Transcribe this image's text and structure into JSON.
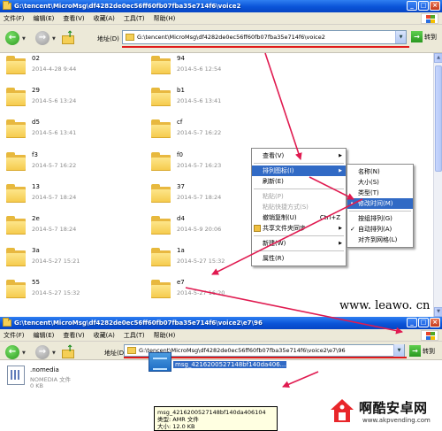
{
  "window1": {
    "title": "G:\\tencent\\MicroMsg\\df4282de0ec56ff60fb07fba35e714f6\\voice2",
    "menus": [
      "文件(F)",
      "编辑(E)",
      "查看(V)",
      "收藏(A)",
      "工具(T)",
      "帮助(H)"
    ],
    "address_label": "地址(D)",
    "address": "G:\\tencent\\MicroMsg\\df4282de0ec56ff60fb07fba35e714f6\\voice2",
    "go_label": "转到",
    "folders_left": [
      {
        "name": "02",
        "date": "2014-4-28 9:44"
      },
      {
        "name": "29",
        "date": "2014-5-6 13:24"
      },
      {
        "name": "d5",
        "date": "2014-5-6 13:41"
      },
      {
        "name": "f3",
        "date": "2014-5-7 16:22"
      },
      {
        "name": "13",
        "date": "2014-5-7 18:24"
      },
      {
        "name": "2e",
        "date": "2014-5-7 18:24"
      },
      {
        "name": "3a",
        "date": "2014-5-27 15:21"
      },
      {
        "name": "55",
        "date": "2014-5-27 15:32"
      }
    ],
    "folders_right": [
      {
        "name": "94",
        "date": "2014-5-6 12:54"
      },
      {
        "name": "b1",
        "date": "2014-5-6 13:41"
      },
      {
        "name": "cf",
        "date": "2014-5-7 16:22"
      },
      {
        "name": "f0",
        "date": "2014-5-7 16:23"
      },
      {
        "name": "37",
        "date": "2014-5-7 18:24"
      },
      {
        "name": "d4",
        "date": "2014-5-9 20:06"
      },
      {
        "name": "1a",
        "date": "2014-5-27 15:32"
      },
      {
        "name": "e7",
        "date": "2014-5-27 16:20"
      }
    ]
  },
  "context_menu": {
    "items": [
      {
        "label": "查看(V)",
        "arrow": true,
        "disabled": false
      },
      {
        "sep": true
      },
      {
        "label": "排列图标(I)",
        "arrow": true,
        "highlighted": true
      },
      {
        "label": "刷新(E)"
      },
      {
        "sep": true
      },
      {
        "label": "粘贴(P)",
        "disabled": true
      },
      {
        "label": "粘贴快捷方式(S)",
        "disabled": true
      },
      {
        "label": "撤销复制(U)",
        "shortcut": "Ctrl+Z"
      },
      {
        "label": "共享文件夹同步",
        "arrow": true,
        "icon": true
      },
      {
        "sep": true
      },
      {
        "label": "新建(W)",
        "arrow": true
      },
      {
        "sep": true
      },
      {
        "label": "属性(R)"
      }
    ]
  },
  "submenu": {
    "items": [
      {
        "label": "名称(N)"
      },
      {
        "label": "大小(S)"
      },
      {
        "label": "类型(T)"
      },
      {
        "label": "修改时间(M)",
        "highlighted": true,
        "mark": "•"
      },
      {
        "sep": true
      },
      {
        "label": "按组排列(G)"
      },
      {
        "label": "自动排列(A)",
        "mark": "✓"
      },
      {
        "label": "对齐到网格(L)"
      }
    ]
  },
  "watermark": "www. leawo. cn",
  "window2": {
    "title": "G:\\tencent\\MicroMsg\\df4282de0ec56ff60fb07fba35e714f6\\voice2\\e7\\96",
    "menus": [
      "文件(F)",
      "编辑(E)",
      "查看(V)",
      "收藏(A)",
      "工具(T)",
      "帮助(H)"
    ],
    "address_label": "地址(D)",
    "address": "G:\\tencent\\MicroMsg\\df4282de0ec56ff60fb07fba35e714f6\\voice2\\e7\\96",
    "go_label": "转到",
    "nomedia": {
      "name": ".nomedia",
      "type": "NOMEDIA 文件",
      "size": "0 KB"
    },
    "amr_file": {
      "name": "msg_4216200527148bf140da406..."
    },
    "tooltip": {
      "line1": "msg_4216200527148bf140da406104",
      "line2": "类型: AMR 文件",
      "line3": "大小: 12.0 KB"
    }
  },
  "logo": {
    "title": "啊酷安卓网",
    "subtitle": "www.akpvending.com"
  },
  "colors": {
    "title_blue": "#0a54d8",
    "highlight": "#316ac5",
    "annotation_red": "#e01a50"
  }
}
